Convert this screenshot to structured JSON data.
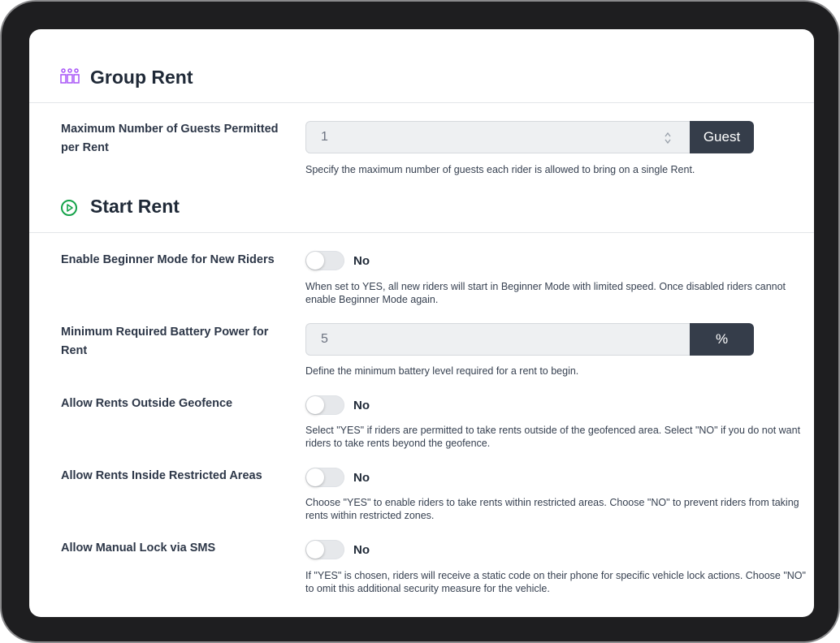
{
  "group_rent": {
    "title": "Group Rent",
    "icon": "group-icon",
    "icon_color": "#a855f7",
    "max_guests": {
      "label": "Maximum Number of Guests Permitted per Rent",
      "value": "1",
      "unit": "Guest",
      "description": "Specify the maximum number of guests each rider is allowed to bring on a single Rent."
    }
  },
  "start_rent": {
    "title": "Start Rent",
    "icon": "play-circle-icon",
    "icon_color": "#16a34a",
    "beginner_mode": {
      "label": "Enable Beginner Mode for New Riders",
      "state": "No",
      "description": "When set to YES, all new riders will start in Beginner Mode with limited speed. Once disabled riders cannot enable Beginner Mode again."
    },
    "min_battery": {
      "label": "Minimum Required Battery Power for Rent",
      "value": "5",
      "unit": "%",
      "description": "Define the minimum battery level required for a rent to begin."
    },
    "outside_geofence": {
      "label": "Allow Rents Outside Geofence",
      "state": "No",
      "description": "Select \"YES\" if riders are permitted to take rents outside of the geofenced area. Select \"NO\" if you do not want riders to take rents beyond the geofence."
    },
    "restricted_areas": {
      "label": "Allow Rents Inside Restricted Areas",
      "state": "No",
      "description": "Choose \"YES\" to enable riders to take rents within restricted areas. Choose \"NO\" to prevent riders from taking rents within restricted zones."
    },
    "manual_lock_sms": {
      "label": "Allow Manual Lock via SMS",
      "state": "No",
      "description": "If \"YES\" is chosen, riders will receive a static code on their phone for specific vehicle lock actions. Choose \"NO\" to omit this additional security measure for the vehicle."
    }
  },
  "colors": {
    "addon_bg": "#353d4a",
    "input_bg": "#eef0f2",
    "toggle_off": "#e6e8eb"
  }
}
